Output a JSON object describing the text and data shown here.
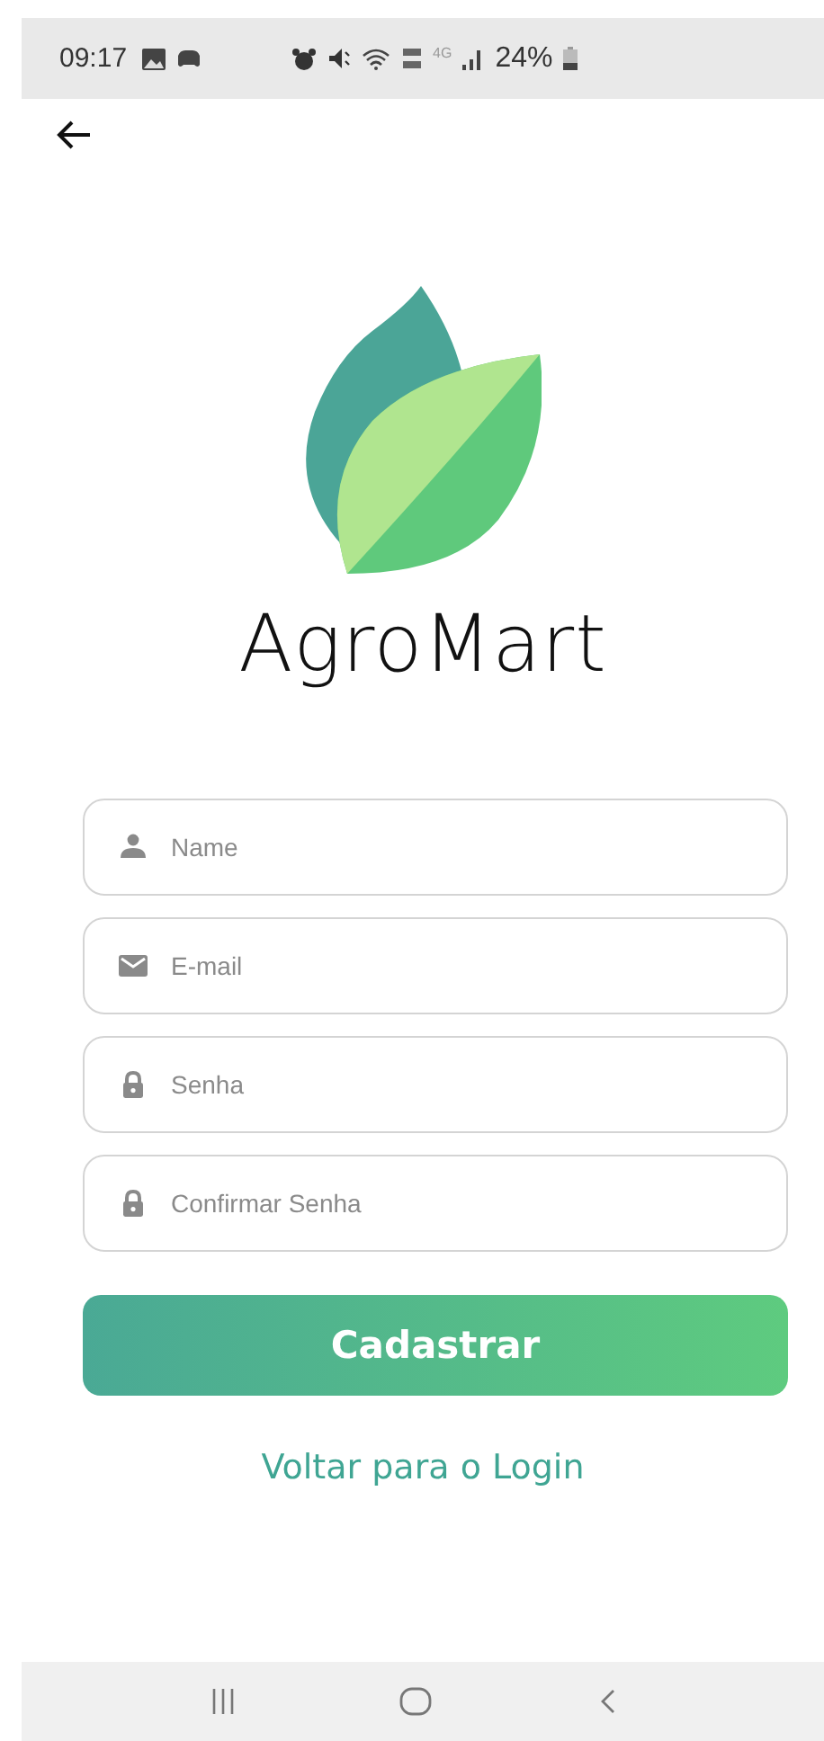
{
  "status_bar": {
    "time": "09:17",
    "network": "4G",
    "battery": "24%"
  },
  "app": {
    "name": "AgroMart"
  },
  "fields": [
    {
      "kind": "person",
      "placeholder": "Name"
    },
    {
      "kind": "mail",
      "placeholder": "E-mail"
    },
    {
      "kind": "lock",
      "placeholder": "Senha"
    },
    {
      "kind": "lock",
      "placeholder": "Confirmar Senha"
    }
  ],
  "submit_button": "Cadastrar",
  "login_link": "Voltar para o Login"
}
